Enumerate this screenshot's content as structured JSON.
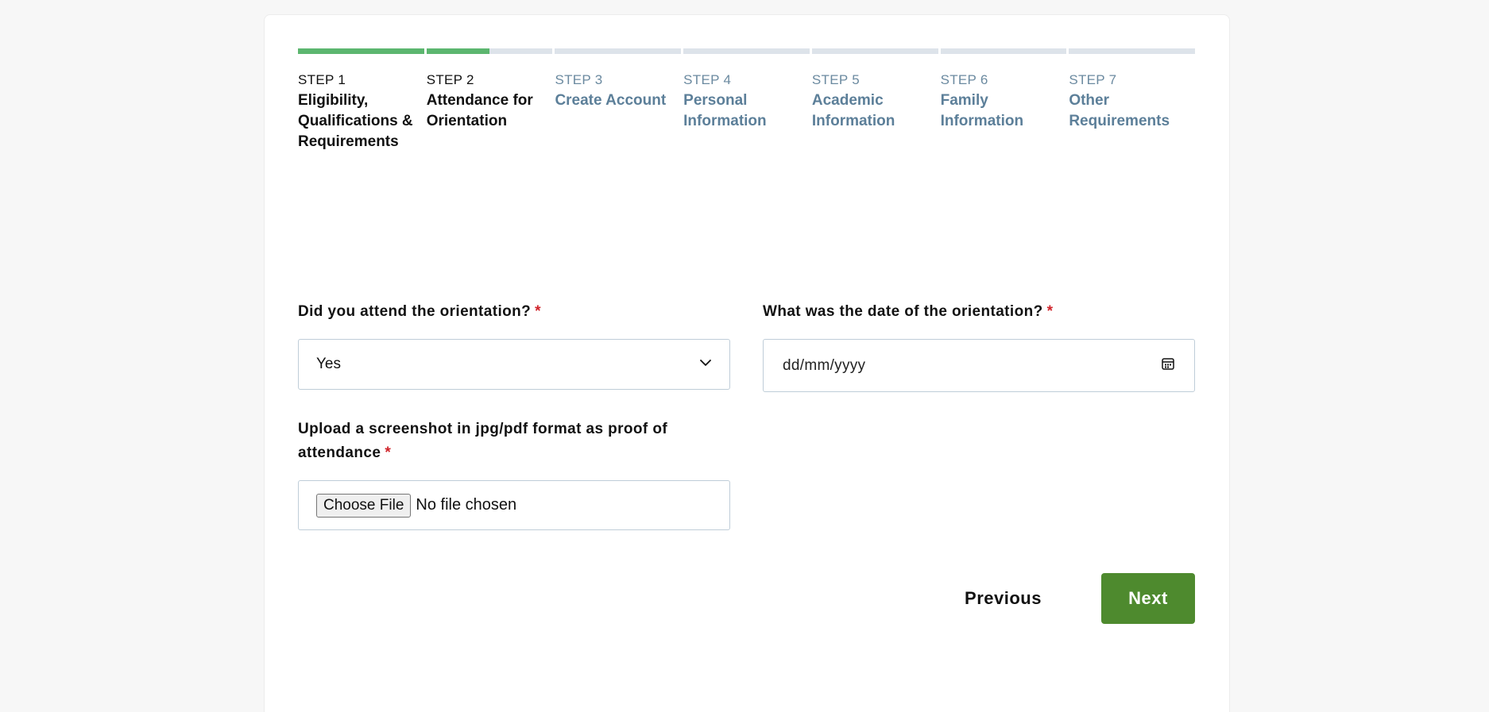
{
  "steps": [
    {
      "number": "STEP 1",
      "title": "Eligibility, Qualifications & Requirements",
      "state": "done",
      "progress": 1.0
    },
    {
      "number": "STEP 2",
      "title": "Attendance for Orientation",
      "state": "active",
      "progress": 0.5
    },
    {
      "number": "STEP 3",
      "title": "Create Account",
      "state": "pending",
      "progress": 0
    },
    {
      "number": "STEP 4",
      "title": "Personal Information",
      "state": "pending",
      "progress": 0
    },
    {
      "number": "STEP 5",
      "title": "Academic Information",
      "state": "pending",
      "progress": 0
    },
    {
      "number": "STEP 6",
      "title": "Family Information",
      "state": "pending",
      "progress": 0
    },
    {
      "number": "STEP 7",
      "title": "Other Requirements",
      "state": "pending",
      "progress": 0
    }
  ],
  "form": {
    "attended": {
      "label": "Did you attend the orientation?",
      "required_mark": "*",
      "value": "Yes"
    },
    "date": {
      "label": "What was the date of the orientation?",
      "required_mark": "*",
      "placeholder": "dd/mm/yyyy"
    },
    "upload": {
      "label": "Upload a screenshot in jpg/pdf format as proof of attendance",
      "required_mark": "*",
      "button_label": "Choose File",
      "status": "No file chosen"
    }
  },
  "actions": {
    "previous_label": "Previous",
    "next_label": "Next"
  },
  "colors": {
    "progress_fill": "#5cb66f",
    "progress_track": "#dde3ea",
    "next_button": "#4e8a2e",
    "required": "#d0232a",
    "pending_text": "#5c7f99"
  },
  "icons": {
    "dropdown": "chevron-down-icon",
    "date": "calendar-icon"
  }
}
